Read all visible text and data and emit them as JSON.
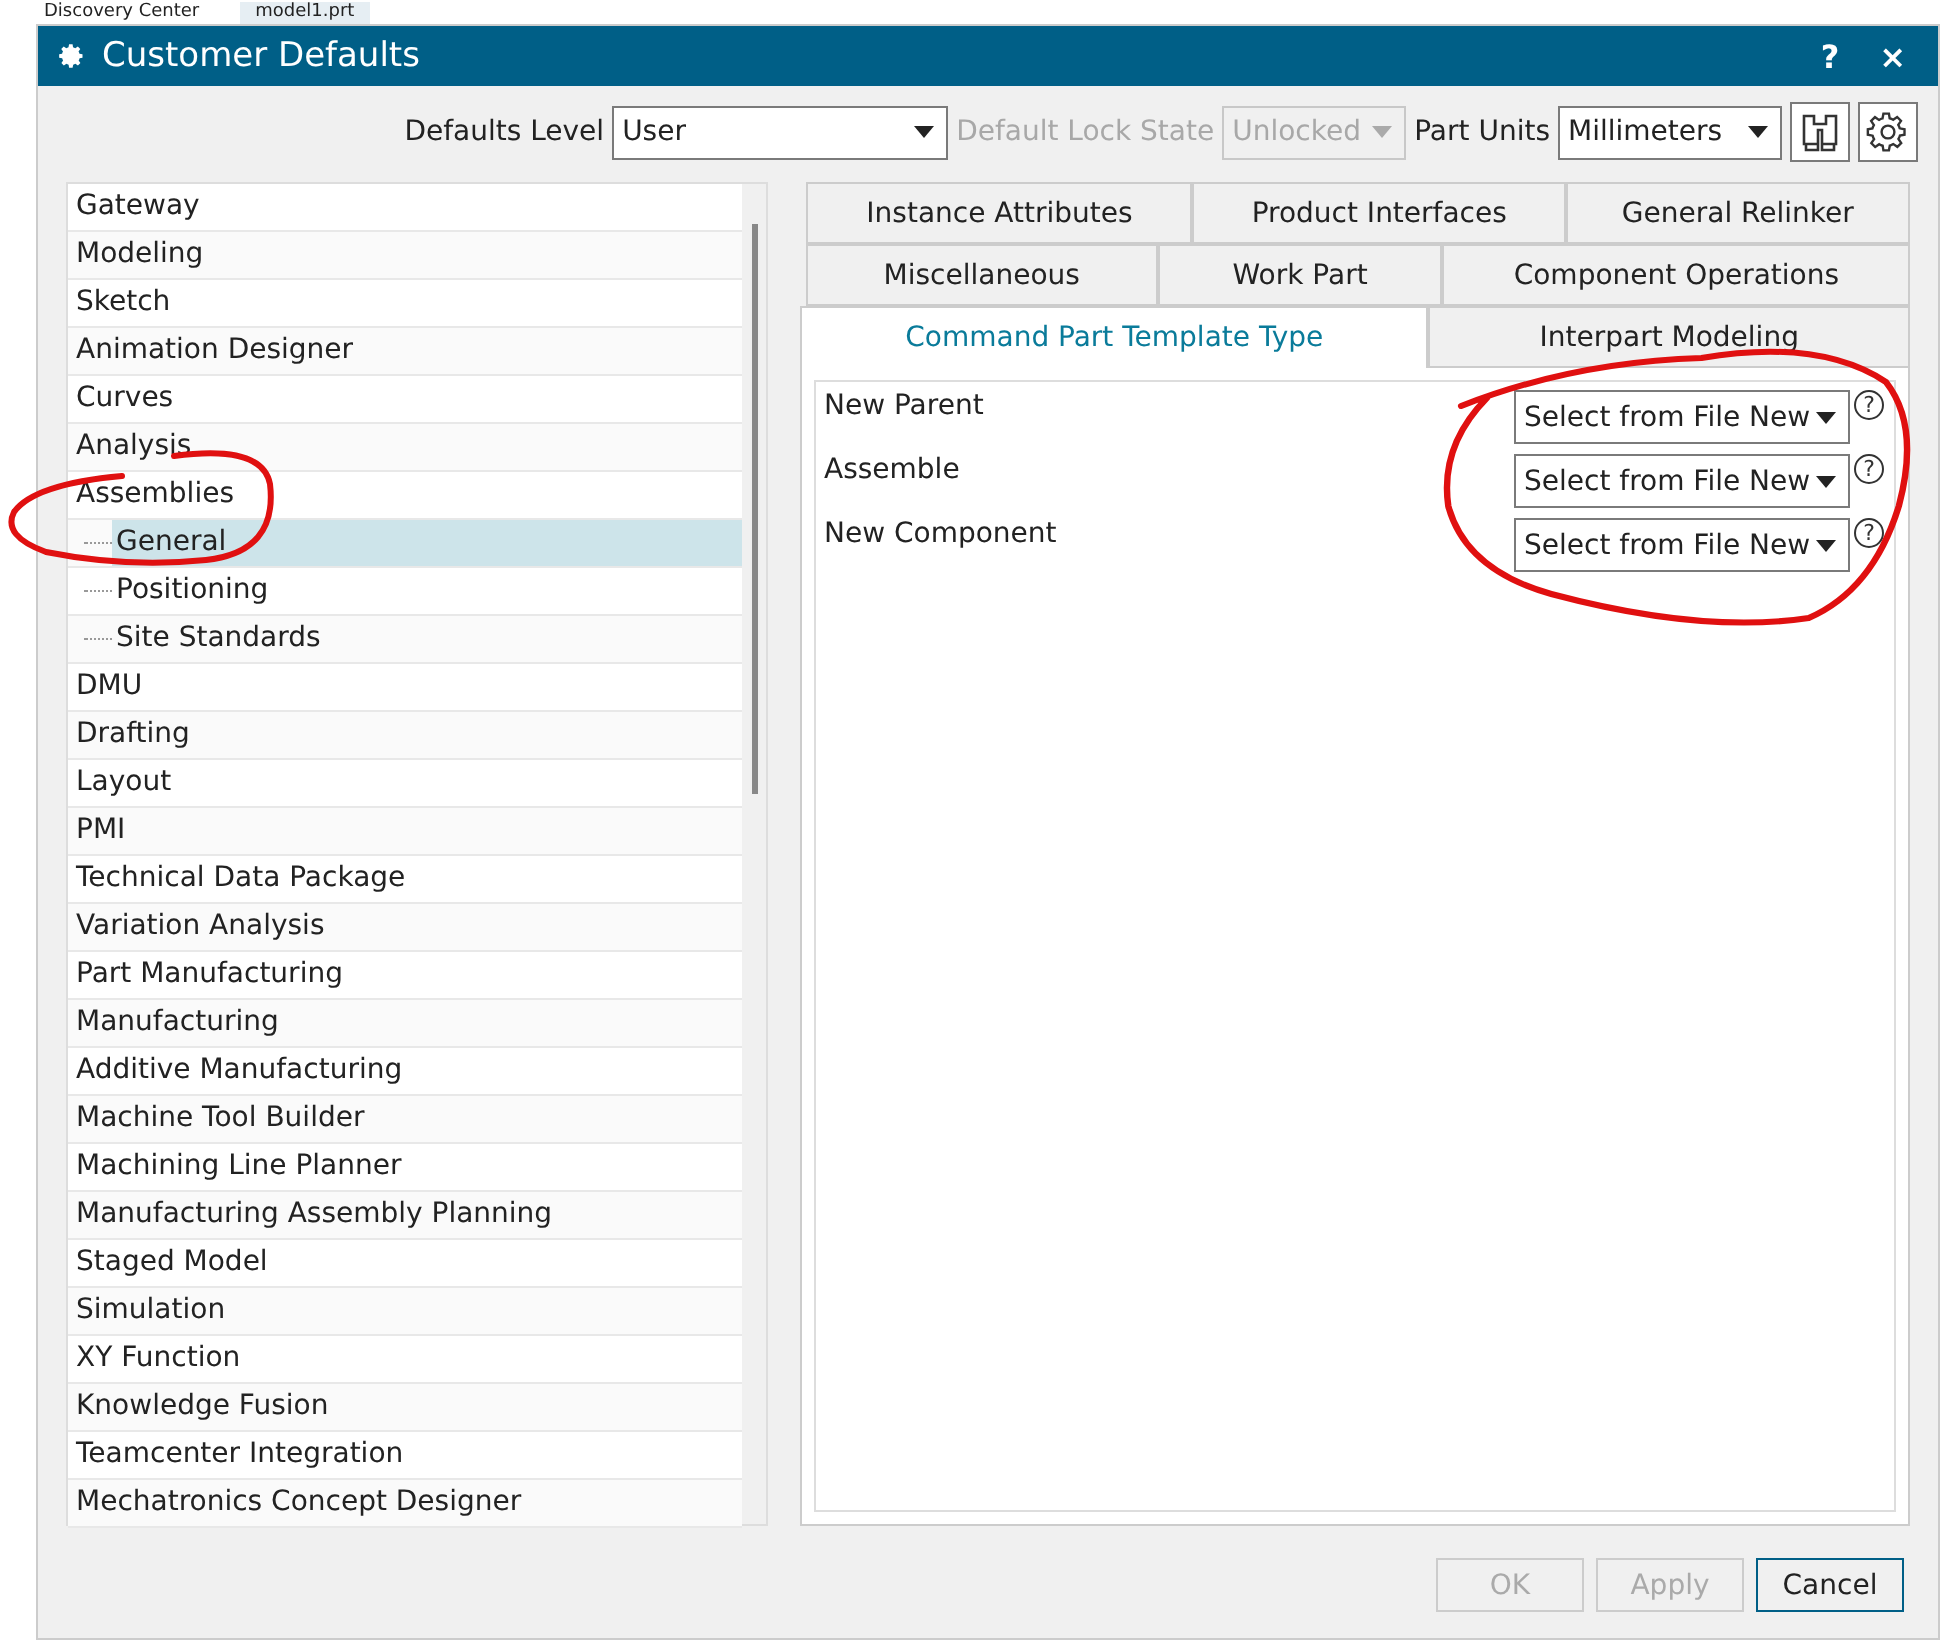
{
  "app_tabs": [
    {
      "label": "Discovery Center",
      "selected": false
    },
    {
      "label": "model1.prt",
      "selected": true
    }
  ],
  "window": {
    "title": "Customer Defaults",
    "help": "?",
    "close": "×"
  },
  "toolbar": {
    "defaults_level": {
      "label": "Defaults Level",
      "value": "User",
      "disabled": false
    },
    "lock_state": {
      "label": "Default Lock State",
      "value": "Unlocked",
      "disabled": true
    },
    "part_units": {
      "label": "Part Units",
      "value": "Millimeters",
      "disabled": false
    }
  },
  "tree": [
    {
      "label": "Gateway",
      "selected": false
    },
    {
      "label": "Modeling",
      "selected": false
    },
    {
      "label": "Sketch",
      "selected": false
    },
    {
      "label": "Animation Designer",
      "selected": false
    },
    {
      "label": "Curves",
      "selected": false
    },
    {
      "label": "Analysis",
      "selected": false
    },
    {
      "label": "Assemblies",
      "selected": false,
      "children": [
        {
          "label": "General",
          "selected": true
        },
        {
          "label": "Positioning",
          "selected": false
        },
        {
          "label": "Site Standards",
          "selected": false
        }
      ]
    },
    {
      "label": "DMU",
      "selected": false
    },
    {
      "label": "Drafting",
      "selected": false
    },
    {
      "label": "Layout",
      "selected": false
    },
    {
      "label": "PMI",
      "selected": false
    },
    {
      "label": "Technical Data Package",
      "selected": false
    },
    {
      "label": "Variation Analysis",
      "selected": false
    },
    {
      "label": "Part Manufacturing",
      "selected": false
    },
    {
      "label": "Manufacturing",
      "selected": false
    },
    {
      "label": "Additive Manufacturing",
      "selected": false
    },
    {
      "label": "Machine Tool Builder",
      "selected": false
    },
    {
      "label": "Machining Line Planner",
      "selected": false
    },
    {
      "label": "Manufacturing Assembly Planning",
      "selected": false
    },
    {
      "label": "Staged Model",
      "selected": false
    },
    {
      "label": "Simulation",
      "selected": false
    },
    {
      "label": "XY Function",
      "selected": false
    },
    {
      "label": "Knowledge Fusion",
      "selected": false
    },
    {
      "label": "Teamcenter Integration",
      "selected": false
    },
    {
      "label": "Mechatronics Concept Designer",
      "selected": false
    }
  ],
  "tab_rows": [
    [
      {
        "label": "Instance Attributes",
        "selected": false
      },
      {
        "label": "Product Interfaces",
        "selected": false
      },
      {
        "label": "General Relinker",
        "selected": false
      }
    ],
    [
      {
        "label": "Miscellaneous",
        "selected": false
      },
      {
        "label": "Work Part",
        "selected": false
      },
      {
        "label": "Component Operations",
        "selected": false
      }
    ],
    [
      {
        "label": "Command Part Template Type",
        "selected": true
      },
      {
        "label": "Interpart Modeling",
        "selected": false
      }
    ]
  ],
  "settings": [
    {
      "label": "New Parent",
      "value": "Select from File New",
      "help": "?"
    },
    {
      "label": "Assemble",
      "value": "Select from File New",
      "help": "?"
    },
    {
      "label": "New Component",
      "value": "Select from File New",
      "help": "?"
    }
  ],
  "buttons": [
    {
      "label": "OK",
      "disabled": true,
      "kind": "default"
    },
    {
      "label": "Apply",
      "disabled": true,
      "kind": "default"
    },
    {
      "label": "Cancel",
      "disabled": false,
      "kind": "primary"
    }
  ]
}
